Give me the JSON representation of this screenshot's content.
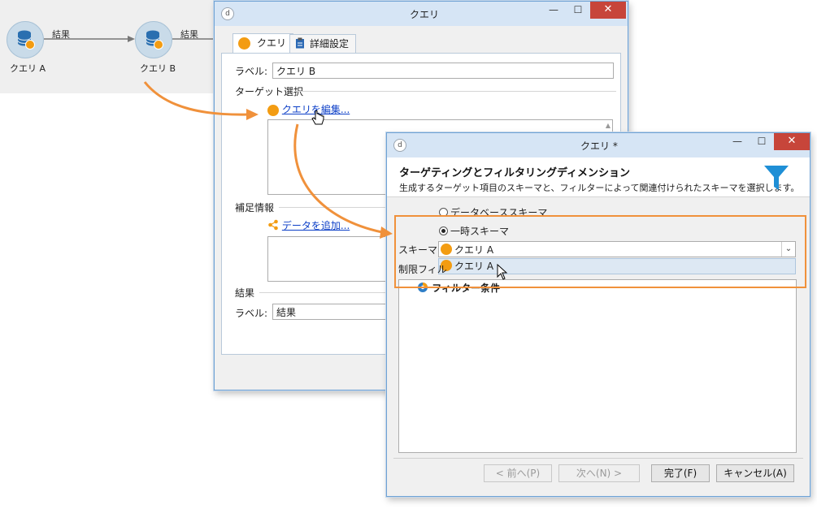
{
  "workflow": {
    "node_a_label": "クエリ A",
    "node_b_label": "クエリ B",
    "edge_1_label": "結果",
    "edge_2_label": "結果"
  },
  "back_window": {
    "title": "クエリ",
    "tabs": [
      {
        "label": "クエリ",
        "icon": "orange-circle-icon"
      },
      {
        "label": "詳細設定",
        "icon": "clipboard-icon"
      }
    ],
    "label_caption": "ラベル:",
    "label_value": "クエリ B",
    "target_section": "ターゲット選択",
    "edit_query_link": "クエリを編集...",
    "extra_section": "補足情報",
    "add_data_link": "データを追加...",
    "result_section": "結果",
    "result_label_caption": "ラベル:",
    "result_label_value": "結果"
  },
  "front_window": {
    "title": "クエリ *",
    "heading": "ターゲティングとフィルタリングディメンション",
    "subheading": "生成するターゲット項目のスキーマと、フィルターによって関連付けられたスキーマを選択します。",
    "radio_db_schema": "データベーススキーマ",
    "radio_temp_schema": "一時スキーマ",
    "selected_radio": "一時スキーマ",
    "schema_caption": "スキーマ:",
    "schema_value": "クエリ A",
    "dropdown_options": [
      "クエリ A"
    ],
    "restrict_caption": "制限フィル",
    "filter_condition": "フィルター条件",
    "buttons": {
      "prev": "< 前へ(P)",
      "next": "次へ(N) >",
      "finish": "完了(F)",
      "cancel": "キャンセル(A)"
    },
    "accent_color": "#f0913b",
    "funnel_color": "#1f8fd6"
  }
}
